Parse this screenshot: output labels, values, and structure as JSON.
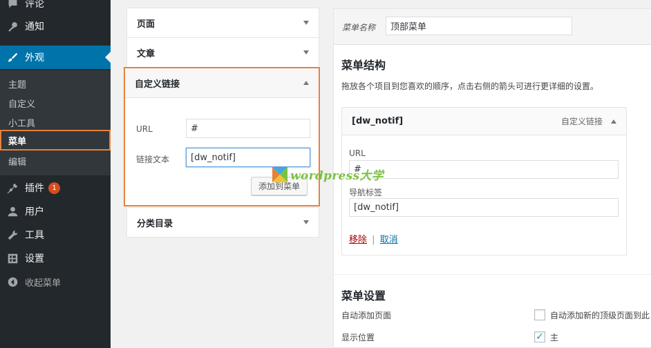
{
  "sidebar": {
    "items": [
      {
        "label": "评论",
        "icon": "comment-icon"
      },
      {
        "label": "通知",
        "icon": "key-icon"
      },
      {
        "label": "外观",
        "icon": "brush-icon"
      },
      {
        "label": "插件",
        "icon": "plugin-icon",
        "badge": "1"
      },
      {
        "label": "用户",
        "icon": "user-icon"
      },
      {
        "label": "工具",
        "icon": "wrench-icon"
      },
      {
        "label": "设置",
        "icon": "settings-icon"
      },
      {
        "label": "收起菜单",
        "icon": "collapse-icon"
      }
    ],
    "submenu": [
      "主题",
      "自定义",
      "小工具",
      "菜单",
      "编辑"
    ]
  },
  "left_panels": {
    "pages": {
      "title": "页面"
    },
    "posts": {
      "title": "文章"
    },
    "custom_links": {
      "title": "自定义链接",
      "url_label": "URL",
      "url_value": "#",
      "link_text_label": "链接文本",
      "link_text_value": "[dw_notif]",
      "add_button": "添加到菜单"
    },
    "categories": {
      "title": "分类目录"
    }
  },
  "menu_panel": {
    "name_label": "菜单名称",
    "name_value": "顶部菜单",
    "structure_title": "菜单结构",
    "structure_desc": "拖放各个项目到您喜欢的顺序，点击右侧的箭头可进行更详细的设置。",
    "item": {
      "title": "[dw_notif]",
      "type": "自定义链接",
      "url_label": "URL",
      "url_value": "#",
      "nav_label": "导航标签",
      "nav_value": "[dw_notif]",
      "remove": "移除",
      "separator": "|",
      "cancel": "取消"
    },
    "settings_title": "菜单设置",
    "auto_add_label": "自动添加页面",
    "auto_add_option": "自动添加新的顶级页面到此",
    "display_label": "显示位置",
    "display_option": "主"
  },
  "watermark": {
    "text": "wordpress大学"
  },
  "colors": {
    "accent": "#0073aa",
    "highlight_outline": "#e8813a",
    "sidebar_bg": "#23282d",
    "remove_link": "#a00000"
  }
}
